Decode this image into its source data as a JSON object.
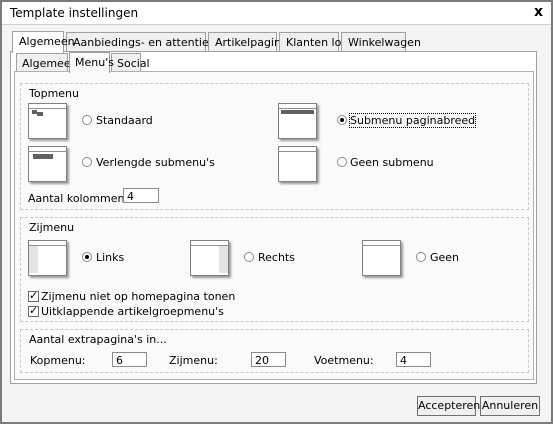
{
  "window": {
    "title": "Template instellingen",
    "close_glyph": "x"
  },
  "tabs": [
    {
      "label": "Algemeen"
    },
    {
      "label": "Aanbiedings- en attentieartikelen"
    },
    {
      "label": "Artikelpagina's"
    },
    {
      "label": "Klanten login"
    },
    {
      "label": "Winkelwagen"
    }
  ],
  "active_tab": "Algemeen",
  "subtabs": [
    {
      "label": "Algemeen"
    },
    {
      "label": "Menu's"
    },
    {
      "label": "Social"
    }
  ],
  "active_subtab": "Menu's",
  "topmenu": {
    "title": "Topmenu",
    "options": [
      {
        "label": "Standaard",
        "checked": false,
        "icon": "standard-menu-thumb"
      },
      {
        "label": "Submenu paginabreed",
        "checked": true,
        "icon": "fullwidth-submenu-thumb"
      },
      {
        "label": "Verlengde submenu's",
        "checked": false,
        "icon": "extended-submenu-thumb"
      },
      {
        "label": "Geen submenu",
        "checked": false,
        "icon": "no-submenu-thumb"
      }
    ],
    "columns_label": "Aantal kolommen:",
    "columns_value": "4"
  },
  "sidemenu": {
    "title": "Zijmenu",
    "options": [
      {
        "label": "Links",
        "checked": true,
        "icon": "left-sidebar-thumb"
      },
      {
        "label": "Rechts",
        "checked": false,
        "icon": "right-sidebar-thumb"
      },
      {
        "label": "Geen",
        "checked": false,
        "icon": "no-sidebar-thumb"
      }
    ],
    "checkboxes": [
      {
        "label": "Zijmenu niet op homepagina tonen",
        "checked": true
      },
      {
        "label": "Uitklappende artikelgroepmenu's",
        "checked": true
      }
    ]
  },
  "extrapages": {
    "title": "Aantal extrapagina's in...",
    "fields": [
      {
        "label": "Kopmenu:",
        "value": "6"
      },
      {
        "label": "Zijmenu:",
        "value": "20"
      },
      {
        "label": "Voetmenu:",
        "value": "4"
      }
    ]
  },
  "buttons": {
    "accept": "Accepteren",
    "cancel": "Annuleren"
  }
}
